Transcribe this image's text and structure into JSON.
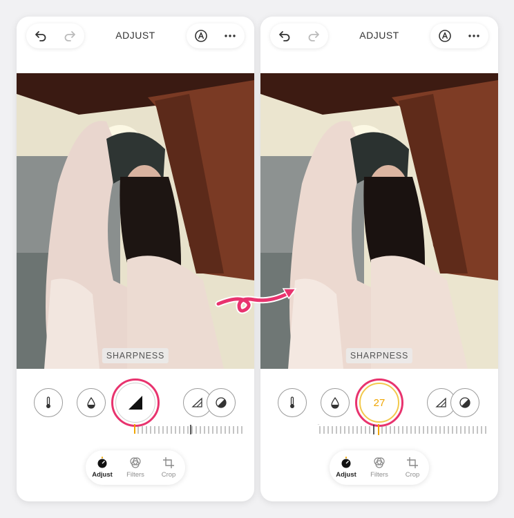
{
  "colors": {
    "accent_pink": "#e8336e",
    "accent_yellow": "#f0a500",
    "text_dark": "#333333"
  },
  "screens": [
    {
      "header": {
        "title": "ADJUST",
        "undo_icon": "undo-icon",
        "redo_icon": "redo-icon",
        "auto_icon": "auto-enhance-icon",
        "more_icon": "more-icon"
      },
      "overlay_label": "SHARPNESS",
      "tools": [
        {
          "icon": "temperature-icon"
        },
        {
          "icon": "tint-icon"
        },
        {
          "icon": "sharpness-icon",
          "active": true
        },
        {
          "icon": "structure-icon"
        },
        {
          "icon": "contrast-icon"
        }
      ],
      "active_value": "",
      "nav": {
        "adjust": "Adjust",
        "filters": "Filters",
        "crop": "Crop"
      }
    },
    {
      "header": {
        "title": "ADJUST",
        "undo_icon": "undo-icon",
        "redo_icon": "redo-icon",
        "auto_icon": "auto-enhance-icon",
        "more_icon": "more-icon"
      },
      "overlay_label": "SHARPNESS",
      "tools": [
        {
          "icon": "temperature-icon"
        },
        {
          "icon": "tint-icon"
        },
        {
          "icon": "sharpness-value",
          "active": true
        },
        {
          "icon": "structure-icon"
        },
        {
          "icon": "contrast-icon"
        }
      ],
      "active_value": "27",
      "nav": {
        "adjust": "Adjust",
        "filters": "Filters",
        "crop": "Crop"
      }
    }
  ]
}
